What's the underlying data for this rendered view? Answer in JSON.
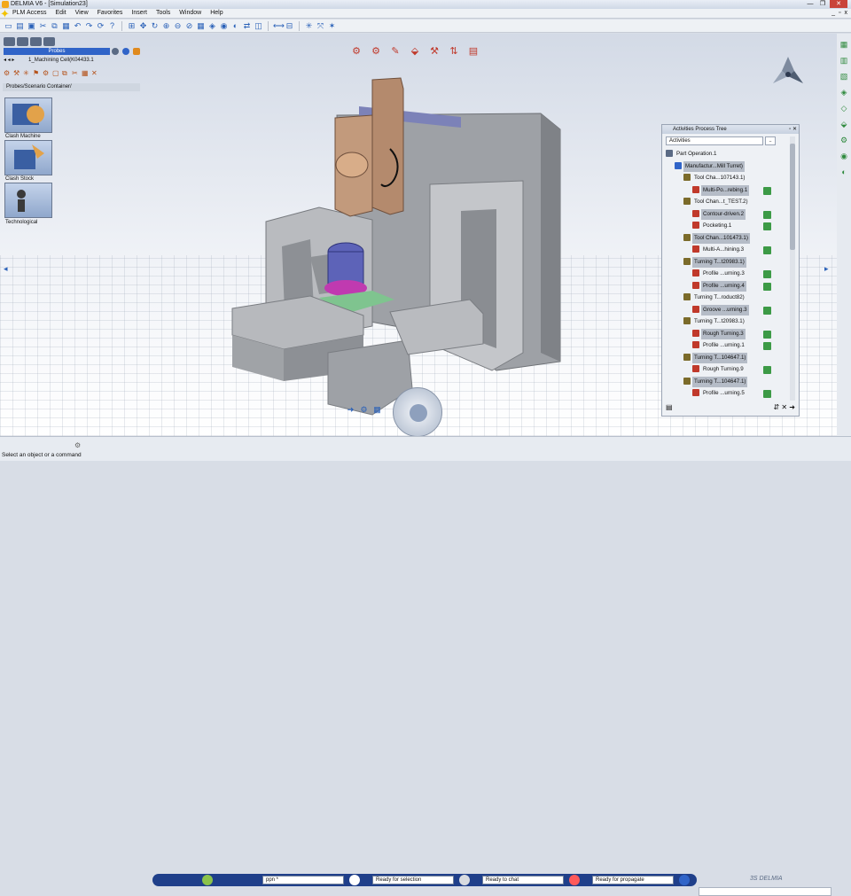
{
  "window": {
    "title": "DELMIA V6 - [Simulation23]",
    "buttons": [
      "—",
      "❐",
      "✕"
    ]
  },
  "menu": {
    "items": [
      "PLM Access",
      "Edit",
      "View",
      "Favorites",
      "Insert",
      "Tools",
      "Window",
      "Help"
    ],
    "window_controls": [
      "_",
      "▫",
      "x"
    ]
  },
  "left_panel": {
    "probes_header": "Probes",
    "probe_scope": "1_Machining Cell(K04433.1",
    "section_title": "Probes/Scenario Container/",
    "tiles": [
      {
        "label": "Clash Machine"
      },
      {
        "label": "Clash Stock"
      },
      {
        "label": "Technological"
      }
    ]
  },
  "tree_panel": {
    "title": "Activities Process Tree",
    "filter_label": "Activities",
    "filter_button": "..",
    "rows": [
      {
        "label": "Part Operation.1",
        "indent": 0,
        "selected": false,
        "check": false
      },
      {
        "label": "Manufactur...Mill Turret)",
        "indent": 1,
        "selected": true,
        "check": false
      },
      {
        "label": "Tool Cha...107143.1)",
        "indent": 2,
        "selected": false,
        "check": false
      },
      {
        "label": "Multi-Po...rebing.1",
        "indent": 3,
        "selected": true,
        "check": true
      },
      {
        "label": "Tool Chan...t_TEST.2)",
        "indent": 2,
        "selected": false,
        "check": false
      },
      {
        "label": "Contour-driven.2",
        "indent": 3,
        "selected": true,
        "check": true
      },
      {
        "label": "Pocketing.1",
        "indent": 3,
        "selected": false,
        "check": true
      },
      {
        "label": "Tool Chan...101473.1)",
        "indent": 2,
        "selected": true,
        "check": false
      },
      {
        "label": "Multi-A...hining.3",
        "indent": 3,
        "selected": false,
        "check": true
      },
      {
        "label": "Turning T...t20983.1)",
        "indent": 2,
        "selected": true,
        "check": false
      },
      {
        "label": "Profile ...urning.3",
        "indent": 3,
        "selected": false,
        "check": true
      },
      {
        "label": "Profile ...urning.4",
        "indent": 3,
        "selected": true,
        "check": true
      },
      {
        "label": "Turning T...roduct82)",
        "indent": 2,
        "selected": false,
        "check": false
      },
      {
        "label": "Groove ...urning.3",
        "indent": 3,
        "selected": true,
        "check": true
      },
      {
        "label": "Turning T...t20983.1)",
        "indent": 2,
        "selected": false,
        "check": false
      },
      {
        "label": "Rough Turning.3",
        "indent": 3,
        "selected": true,
        "check": true
      },
      {
        "label": "Profile ...urning.1",
        "indent": 3,
        "selected": false,
        "check": true
      },
      {
        "label": "Turning T...104647.1)",
        "indent": 2,
        "selected": true,
        "check": false
      },
      {
        "label": "Rough Turning.9",
        "indent": 3,
        "selected": false,
        "check": true
      },
      {
        "label": "Turning T...104647.1)",
        "indent": 2,
        "selected": true,
        "check": false
      },
      {
        "label": "Profile ...urning.5",
        "indent": 3,
        "selected": false,
        "check": true
      }
    ]
  },
  "statusbar": {
    "search_value": "ppn *",
    "status_selection": "Ready for selection",
    "status_chat": "Ready to chat",
    "status_propagate": "Ready for propagate",
    "prompt": "Select an object or a command",
    "brand": "3S DELMIA"
  },
  "colors": {
    "accent": "#3064c8",
    "check": "#3c9a46",
    "selected_row": "#b5bcc7"
  }
}
